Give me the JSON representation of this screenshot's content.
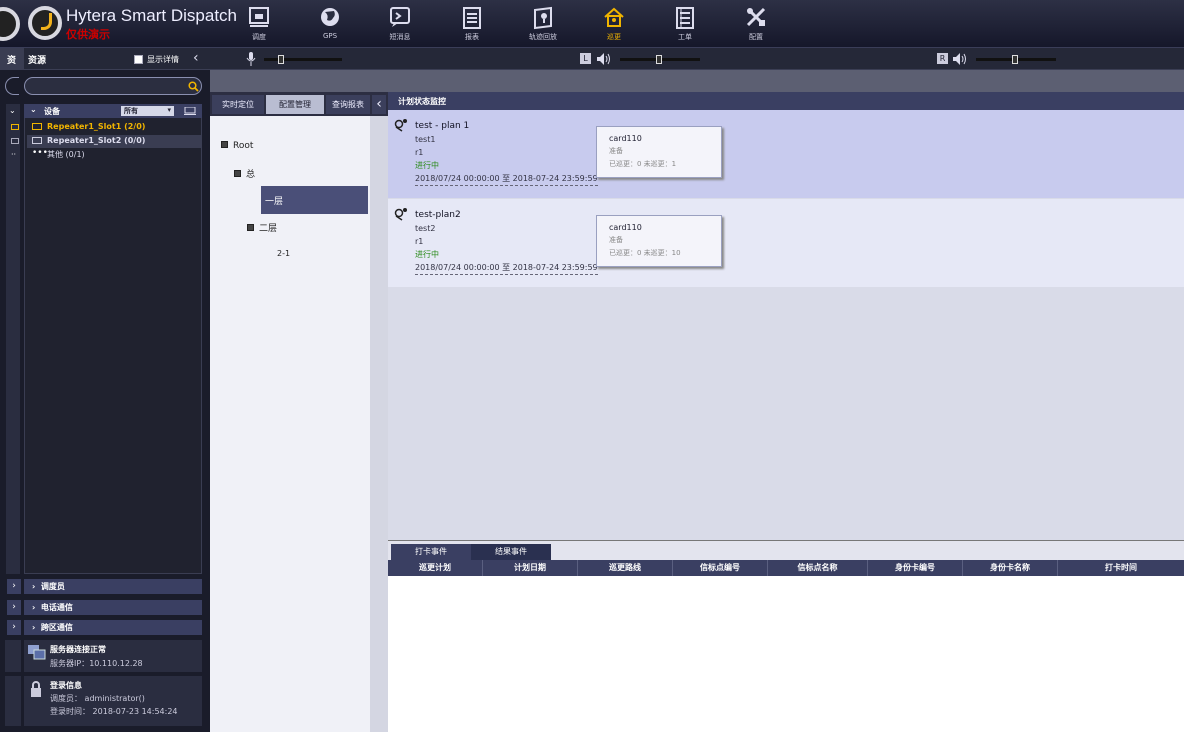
{
  "header": {
    "title": "Hytera Smart Dispatch",
    "subtitle": "仅供演示"
  },
  "nav": [
    {
      "label": "调度",
      "icon": "dispatch-icon"
    },
    {
      "label": "GPS",
      "icon": "globe-icon"
    },
    {
      "label": "短消息",
      "icon": "message-icon"
    },
    {
      "label": "报表",
      "icon": "report-icon"
    },
    {
      "label": "轨迹回放",
      "icon": "track-icon"
    },
    {
      "label": "巡更",
      "icon": "patrol-icon",
      "active": true
    },
    {
      "label": "工单",
      "icon": "workorder-icon"
    },
    {
      "label": "配置",
      "icon": "tools-icon"
    }
  ],
  "audio": {
    "left_label": "L",
    "right_label": "R"
  },
  "left": {
    "ghost_label": "资",
    "title": "资源",
    "show_detail": "显示详情",
    "devices_label": "设备",
    "filter_value": "所有",
    "devices": [
      {
        "label": "Repeater1_Slot1 (2/0)"
      },
      {
        "label": "Repeater1_Slot2 (0/0)"
      },
      {
        "label": "其他 (0/1)"
      }
    ],
    "sections": [
      "调度员",
      "电话通信",
      "跨区通信"
    ],
    "server": {
      "title": "服务器连接正常",
      "ip_label": "服务器IP：",
      "ip": "10.110.12.28"
    },
    "login": {
      "title": "登录信息",
      "user_label": "调度员：",
      "user": "administrator()",
      "time_label": "登录时间：",
      "time": "2018-07-23 14:54:24"
    }
  },
  "tabs": [
    "实时定位",
    "配置管理",
    "查询报表"
  ],
  "tree": {
    "root": "Root",
    "n1": "总",
    "n2": "一层",
    "n3": "二层",
    "n4": "2-1"
  },
  "main": {
    "header": "计划状态监控",
    "plans": [
      {
        "name": "test - plan 1",
        "line1": "test1",
        "line2": "r1",
        "status": "进行中",
        "range": "2018/07/24 00:00:00 至 2018-07-24 23:59:59",
        "card": {
          "title": "card110",
          "state": "准备",
          "counts": "已巡更：0  未巡更：1"
        }
      },
      {
        "name": "test-plan2",
        "line1": "test2",
        "line2": "r1",
        "status": "进行中",
        "range": "2018/07/24 00:00:00 至 2018-07-24 23:59:59",
        "card": {
          "title": "card110",
          "state": "准备",
          "counts": "已巡更：0  未巡更：10"
        }
      }
    ]
  },
  "events": {
    "tabs": [
      "打卡事件",
      "结果事件"
    ],
    "columns": [
      "巡更计划",
      "计划日期",
      "巡更路线",
      "信标点编号",
      "信标点名称",
      "身份卡编号",
      "身份卡名称",
      "打卡时间"
    ]
  },
  "colors": {
    "accent": "#f0b400",
    "panel": "#3a3f62",
    "ongoing": "#2a8a1a"
  }
}
